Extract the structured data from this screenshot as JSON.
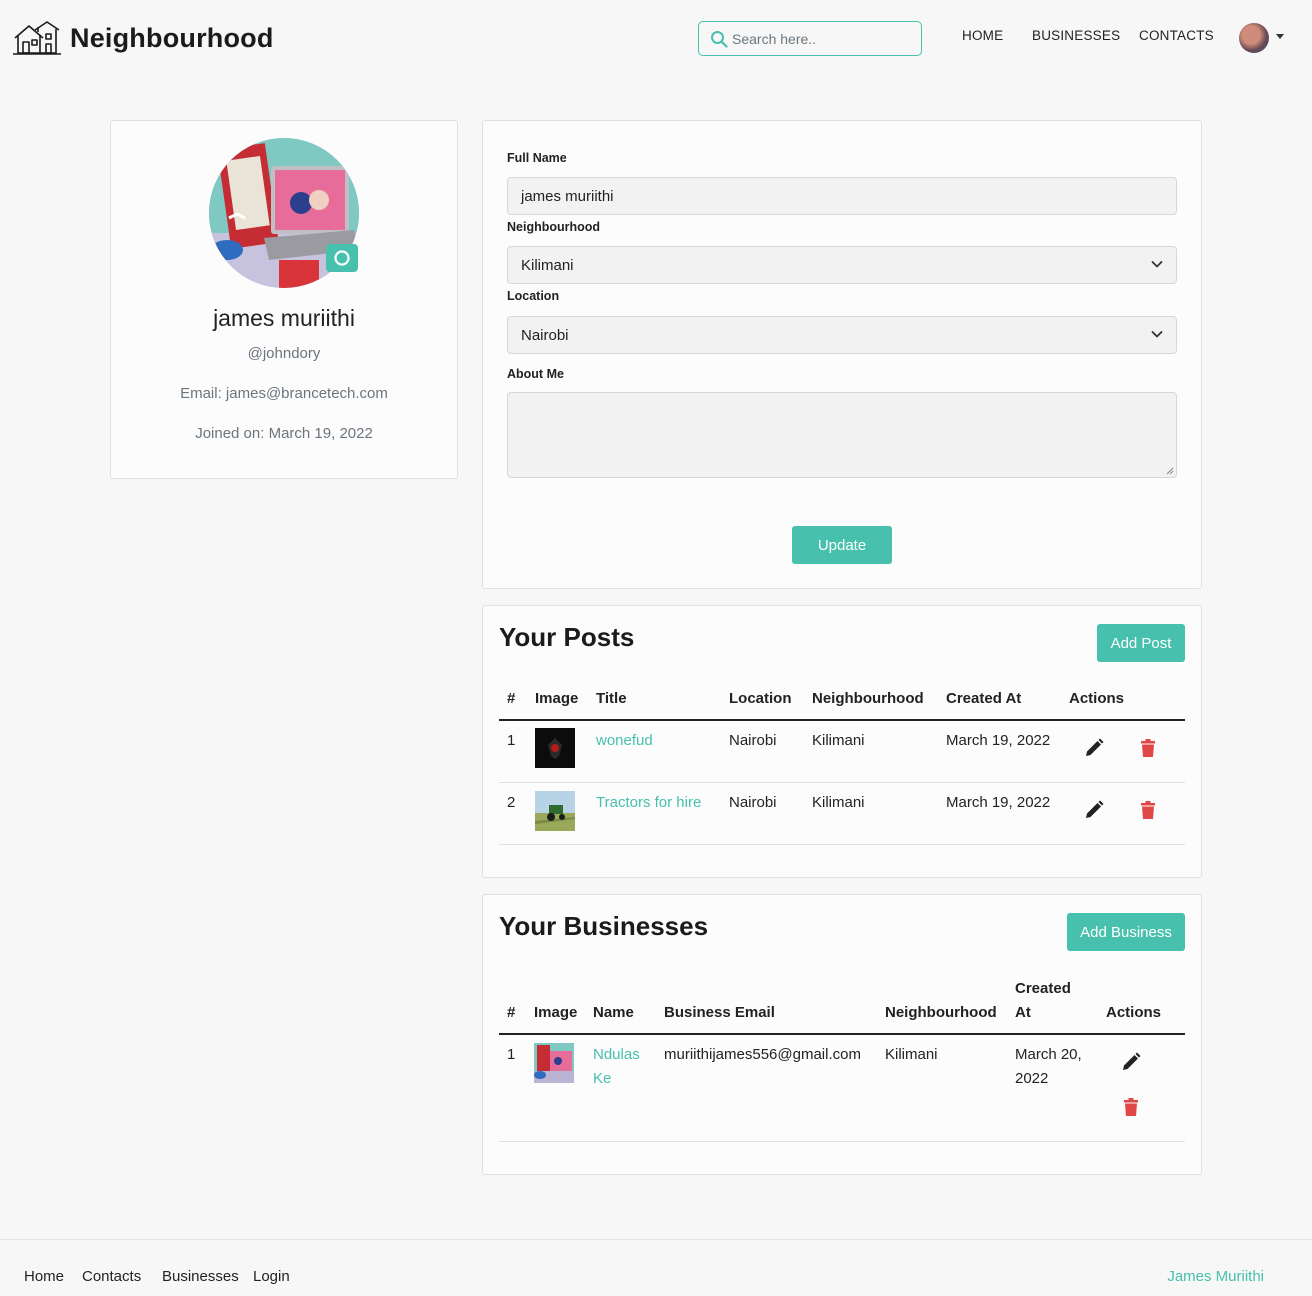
{
  "header": {
    "brand": "Neighbourhood",
    "search_placeholder": "Search here..",
    "nav": [
      "HOME",
      "BUSINESSES",
      "CONTACTS"
    ]
  },
  "profile": {
    "name": "james muriithi",
    "username": "@johndory",
    "email": "Email: james@brancetech.com",
    "joined": "Joined on: March 19, 2022"
  },
  "form": {
    "full_name_label": "Full Name",
    "full_name_value": "james muriithi",
    "neighbourhood_label": "Neighbourhood",
    "neighbourhood_value": "Kilimani",
    "location_label": "Location",
    "location_value": "Nairobi",
    "about_label": "About Me",
    "about_value": "",
    "update_label": "Update"
  },
  "posts": {
    "title": "Your Posts",
    "add_label": "Add Post",
    "headers": [
      "#",
      "Image",
      "Title",
      "Location",
      "Neighbourhood",
      "Created At",
      "Actions"
    ],
    "rows": [
      {
        "num": "1",
        "title": "wonefud",
        "location": "Nairobi",
        "neighbourhood": "Kilimani",
        "created": "March 19, 2022"
      },
      {
        "num": "2",
        "title": "Tractors for hire",
        "location": "Nairobi",
        "neighbourhood": "Kilimani",
        "created": "March 19, 2022"
      }
    ]
  },
  "businesses": {
    "title": "Your Businesses",
    "add_label": "Add Business",
    "headers": [
      "#",
      "Image",
      "Name",
      "Business Email",
      "Neighbourhood",
      "Created",
      "At",
      "Actions"
    ],
    "rows": [
      {
        "num": "1",
        "name_line1": "Ndulas",
        "name_line2": "Ke",
        "email": "muriithijames556@gmail.com",
        "neighbourhood": "Kilimani",
        "created_line1": "March 20,",
        "created_line2": "2022"
      }
    ]
  },
  "footer": {
    "links": [
      "Home",
      "Contacts",
      "Businesses",
      "Login"
    ],
    "user": "James Muriithi"
  },
  "colors": {
    "accent": "#47c1ad",
    "delete": "#e04848"
  }
}
